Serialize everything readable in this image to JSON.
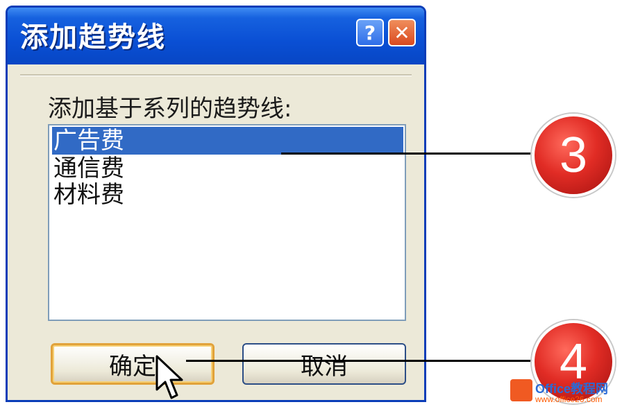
{
  "window": {
    "title": "添加趋势线",
    "help_label": "?",
    "close_label": "✕"
  },
  "dialog": {
    "prompt": "添加基于系列的趋势线:",
    "list_items": [
      {
        "label": "广告费",
        "selected": true
      },
      {
        "label": "通信费",
        "selected": false
      },
      {
        "label": "材料费",
        "selected": false
      }
    ],
    "ok_label": "确定",
    "cancel_label": "取消"
  },
  "annotations": {
    "step3": "3",
    "step4": "4"
  },
  "watermark": {
    "name": "Office教程网",
    "url": "www.office26.com"
  },
  "colors": {
    "titlebar": "#0a4fd4",
    "selection": "#316ac5",
    "badge": "#e12c25"
  }
}
